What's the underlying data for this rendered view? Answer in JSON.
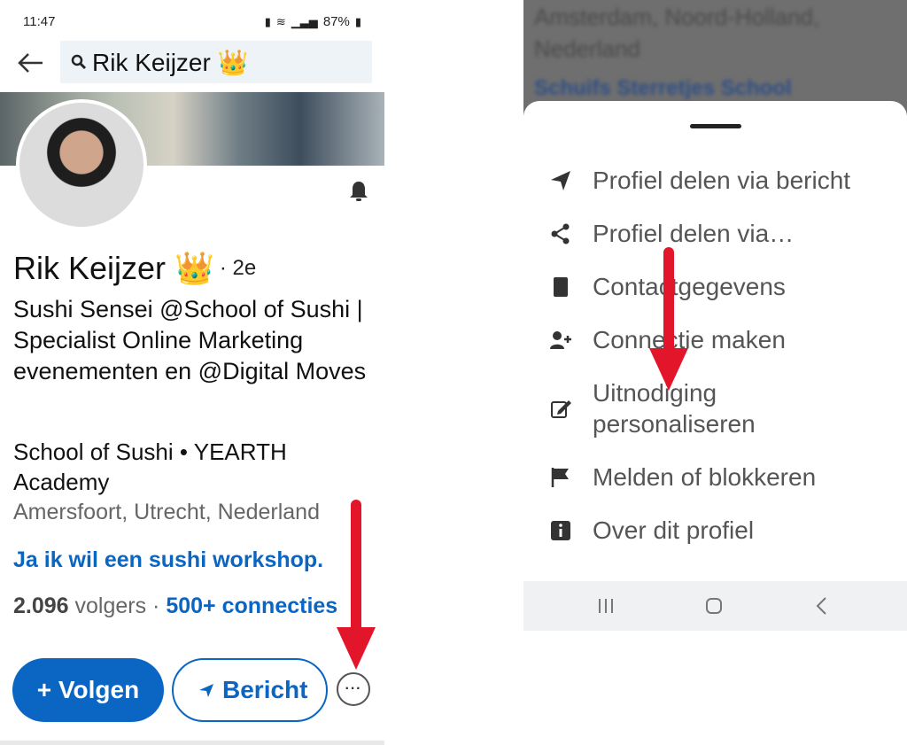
{
  "status_bar": {
    "time": "11:47",
    "battery": "87%"
  },
  "search": {
    "query": "Rik Keijzer 👑"
  },
  "profile": {
    "name": "Rik Keijzer 👑",
    "degree": "· 2e",
    "headline": "Sushi Sensei @School of Sushi | Specialist Online Marketing evenementen en @Digital Moves",
    "company": "School of Sushi • YEARTH Academy",
    "location": "Amersfoort, Utrecht, Nederland",
    "link": "Ja ik wil een sushi workshop.",
    "followers_count": "2.096",
    "followers_label": "volgers ·",
    "connections": "500+ connecties"
  },
  "actions": {
    "follow": "+ Volgen",
    "message": "Bericht",
    "more": "···"
  },
  "background_page": {
    "line1": "Amsterdam, Noord-Holland,",
    "line2": "Nederland",
    "line3": "Schuifs Sterretjes School"
  },
  "menu": {
    "items": [
      {
        "icon": "send-icon",
        "label": "Profiel delen via bericht"
      },
      {
        "icon": "share-icon",
        "label": "Profiel delen via…"
      },
      {
        "icon": "contact-book-icon",
        "label": "Contactgegevens"
      },
      {
        "icon": "add-person-icon",
        "label": "Connectie maken"
      },
      {
        "icon": "edit-icon",
        "label": "Uitnodiging personaliseren"
      },
      {
        "icon": "flag-icon",
        "label": "Melden of blokkeren"
      },
      {
        "icon": "info-icon",
        "label": "Over dit profiel"
      }
    ]
  },
  "colors": {
    "accent": "#0a66c2",
    "arrow": "#e3152b"
  }
}
